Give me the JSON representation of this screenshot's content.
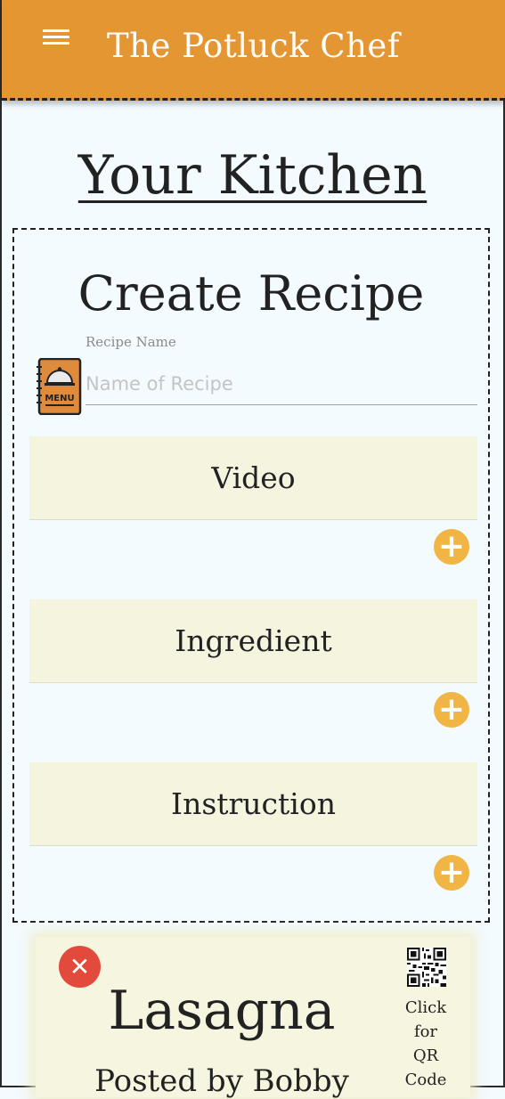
{
  "header": {
    "title": "The Potluck Chef",
    "menu_icon": "hamburger-icon",
    "color": "#e39632"
  },
  "page": {
    "title": "Your Kitchen"
  },
  "create_recipe": {
    "title": "Create Recipe",
    "recipe_name": {
      "label": "Recipe Name",
      "placeholder": "Name of Recipe",
      "value": ""
    },
    "sections": [
      {
        "label": "Video",
        "add_icon": "plus-circle-icon"
      },
      {
        "label": "Ingredient",
        "add_icon": "plus-circle-icon"
      },
      {
        "label": "Instruction",
        "add_icon": "plus-circle-icon"
      }
    ]
  },
  "recipe_card": {
    "title": "Lasagna",
    "subtitle": "Posted by Bobby",
    "qr_lines": [
      "Click",
      "for",
      "QR",
      "Code"
    ],
    "close_icon": "close-icon",
    "qr_icon": "qr-code-icon"
  }
}
